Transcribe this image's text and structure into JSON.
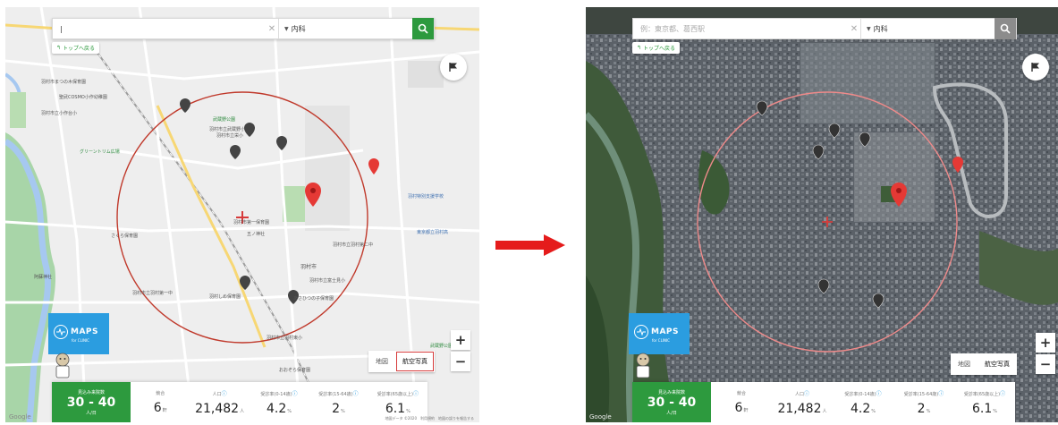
{
  "left_panel": {
    "search": {
      "value": "|",
      "placeholder": ""
    },
    "department": "内科",
    "back_label": "トップへ戻る",
    "maptype": {
      "map": "地図",
      "satellite": "航空写真"
    },
    "logo": {
      "text": "MAPS",
      "sub": "for CLINIC"
    },
    "google": "Google",
    "copyright": "地図データ ©2020　利用規約　地図の誤りを報告する",
    "labels": [
      "羽村市まつの木保育園",
      "聖武COSMO小作幼稚園",
      "羽村市立小作台小",
      "グリーントリム広場",
      "さくら保育園",
      "阿蘇神社",
      "羽村市立羽村第一中",
      "羽村しめ保育園",
      "おおぞら保育園",
      "羽村市立富士見小",
      "羽村市立武蔵野小",
      "羽村市第一保育園",
      "羽村市",
      "羽村特別支援学校",
      "東京都立羽村高",
      "あさひつの子保育園",
      "羽村市立羽村第二中",
      "羽村市立羽村東小",
      "羽村市立栄小",
      "武蔵野公園",
      "五ノ神社",
      "武蔵野公園"
    ]
  },
  "right_panel": {
    "search": {
      "value": "",
      "placeholder": "例：東京都、葛西駅"
    },
    "department": "内科",
    "back_label": "トップへ戻る",
    "maptype": {
      "map": "地図",
      "satellite": "航空写真"
    },
    "logo": {
      "text": "MAPS",
      "sub": "for CLINIC"
    },
    "google": "Google"
  },
  "stats": {
    "patients_label": "見込み来院数",
    "patients_value": "30 - 40",
    "patients_unit": "人/日",
    "items": [
      {
        "label": "競合",
        "value": "6",
        "unit": "軒",
        "help": false
      },
      {
        "label": "人口",
        "value": "21,482",
        "unit": "人",
        "help": true
      },
      {
        "label": "受診率(0-14歳)",
        "value": "4.2",
        "unit": "%",
        "help": true
      },
      {
        "label": "受診率(15-64歳)",
        "value": "2",
        "unit": "%",
        "help": true
      },
      {
        "label": "受診率(65歳以上)",
        "value": "6.1",
        "unit": "%",
        "help": true
      }
    ]
  },
  "colors": {
    "accent_green": "#2d9a3e",
    "logo_blue": "#2b9de0",
    "marker_red": "#e53935",
    "arrow_red": "#e51b1b"
  }
}
